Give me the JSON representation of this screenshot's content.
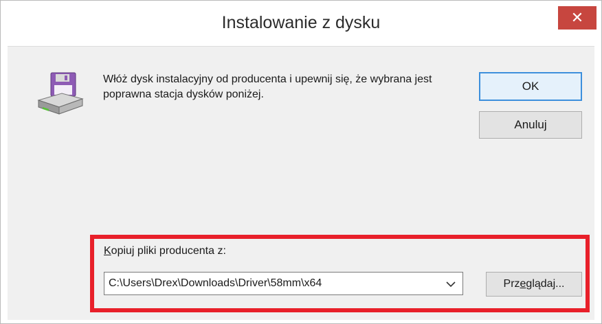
{
  "window": {
    "title": "Instalowanie z dysku",
    "close_glyph": "✕"
  },
  "dialog": {
    "icon": "floppy-disk-drive-icon",
    "message": "Włóż dysk instalacyjny od producenta i upewnij się, że wybrana jest poprawna stacja dysków poniżej.",
    "ok_label": "OK",
    "cancel_label": "Anuluj"
  },
  "copy_from": {
    "label_mnemonic": "K",
    "label_rest": "opiuj pliki producenta z:",
    "path_value": "C:\\Users\\Drex\\Downloads\\Driver\\58mm\\x64",
    "browse_label_pre": "Prz",
    "browse_mnemonic": "e",
    "browse_label_post": "glądaj..."
  },
  "colors": {
    "highlight_border": "#e8202a",
    "close_button": "#c7463f",
    "default_button_border": "#3c8fdc",
    "dialog_background": "#f0f0f0"
  }
}
